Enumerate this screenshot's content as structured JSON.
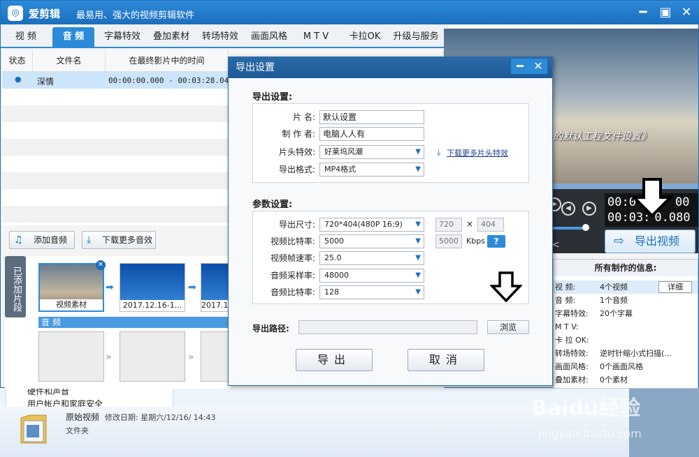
{
  "app": {
    "title": "爱剪辑",
    "slogan": "最易用、强大的视频剪辑软件"
  },
  "tabs": [
    "视 频",
    "音 频",
    "字幕特效",
    "叠加素材",
    "转场特效",
    "画面风格",
    "M T V",
    "卡拉OK",
    "升级与服务"
  ],
  "list": {
    "headers": [
      "状态",
      "文件名",
      "在最终影片中的时间"
    ],
    "rows": [
      {
        "status": "●",
        "name": "深情",
        "time": "00:00:00.000 - 00:03:28.040"
      }
    ]
  },
  "buttons": {
    "add_audio": "添加音频",
    "download_effects": "下载更多音效"
  },
  "clips": {
    "side_label": "已添加片段",
    "items": [
      "视频素材",
      "2017.12.16-1...",
      "2017.12"
    ],
    "audio_track": "音 频"
  },
  "preview": {
    "text": "的默认工程文件设置》",
    "timecode_1": "00:0",
    "timecode_1b": "00",
    "timecode_2": "00:03:",
    "timecode_2b": "0.080"
  },
  "export_video_btn": "导出视频",
  "info": {
    "title": "所有制作的信息:",
    "detail_btn": "详细",
    "rows": [
      {
        "label": "视    频:",
        "value": "4个视频"
      },
      {
        "label": "音    频:",
        "value": "1个音频"
      },
      {
        "label": "字幕特效:",
        "value": "20个字幕"
      },
      {
        "label": "M  T  V:",
        "value": ""
      },
      {
        "label": "卡 拉 OK:",
        "value": ""
      },
      {
        "label": "转场特效:",
        "value": "逆时针缩小式扫描(..."
      },
      {
        "label": "画面风格:",
        "value": "0个画面风格"
      },
      {
        "label": "叠加素材:",
        "value": "0个素材"
      }
    ]
  },
  "dialog": {
    "title": "导出设置",
    "sec1": "导出设置:",
    "name_label": "片    名:",
    "name_value": "默认设置",
    "author_label": "制 作 者:",
    "author_value": "电脑人人有",
    "intro_label": "片头特效:",
    "intro_value": "好莱坞风潮",
    "download_intro": "下载更多片头特效",
    "format_label": "导出格式:",
    "format_value": "MP4格式",
    "sec2": "参数设置:",
    "size_label": "导出尺寸:",
    "size_value": "720*404(480P 16:9)",
    "width": "720",
    "times": "×",
    "height": "404",
    "vbitrate_label": "视频比特率:",
    "vbitrate_value": "5000",
    "vbitrate_custom": "5000",
    "kbps": "Kbps",
    "help": "?",
    "fps_label": "视频帧速率:",
    "fps_value": "25.0",
    "asample_label": "音频采样率:",
    "asample_value": "48000",
    "abitrate_label": "音频比特率:",
    "abitrate_value": "128",
    "path_label": "导出路径:",
    "path_value": "",
    "browse": "浏览",
    "export": "导出",
    "cancel": "取消"
  },
  "explorer": {
    "tree1": "硬件和声音",
    "tree2": "用户帐户和家庭安全",
    "folder_name": "原始视频",
    "modified": "修改日期: 星期六/12/16/ 14:43",
    "type": "文件夹"
  },
  "watermark": {
    "brand": "Baidu经验",
    "url": "jingyan.baidu.com"
  }
}
